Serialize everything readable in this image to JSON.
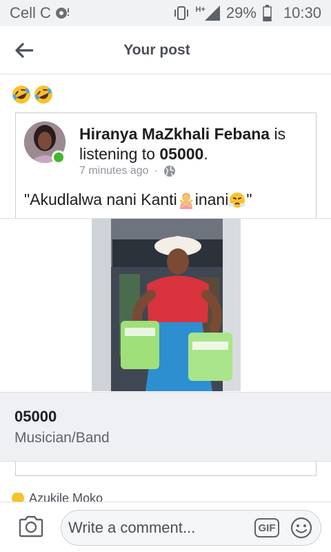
{
  "status_bar": {
    "carrier": "Cell C",
    "network": "H+",
    "battery": "29%",
    "time": "10:30"
  },
  "header": {
    "title": "Your post"
  },
  "post": {
    "caption_emojis": [
      "rolling-on-floor-laughing-icon",
      "rolling-on-floor-laughing-icon"
    ]
  },
  "shared": {
    "author": "Hiranya MaZkhali Febana",
    "verb": "is",
    "activity": "listening to",
    "subject": "05000",
    "time": "7 minutes ago",
    "dot": "·",
    "text_part1": "\"Akudlalwa nani Kanti",
    "text_part2": " inani",
    "text_part3": "\""
  },
  "page_card": {
    "name": "05000",
    "category": "Musician/Band"
  },
  "comment_peek": {
    "text": "Azukile Moko"
  },
  "comment_bar": {
    "placeholder": "Write a comment...",
    "gif_label": "GIF"
  },
  "colors": {
    "online": "#42b72a",
    "background": "#ffffff",
    "page_info_bg": "#eff0f3"
  }
}
